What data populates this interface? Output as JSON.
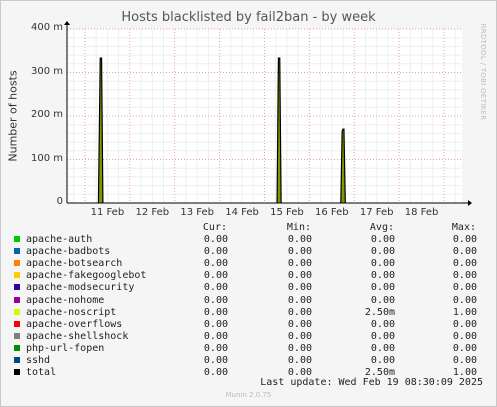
{
  "chart_data": {
    "type": "line",
    "title": "Hosts blacklisted by fail2ban - by week",
    "ylabel": "Number of hosts",
    "ylim": [
      0,
      400
    ],
    "y_unit": "m",
    "yticks": [
      "0",
      "100 m",
      "200 m",
      "300 m",
      "400 m"
    ],
    "ytick_values": [
      0,
      100,
      200,
      300,
      400
    ],
    "xticks": [
      "11 Feb",
      "12 Feb",
      "13 Feb",
      "14 Feb",
      "15 Feb",
      "16 Feb",
      "17 Feb",
      "18 Feb"
    ],
    "xlim_days": [
      10.6,
      19.4
    ],
    "xtick_days": [
      11,
      12,
      13,
      14,
      15,
      16,
      17,
      18
    ],
    "grid": true,
    "series": [
      {
        "name": "apache-noscript",
        "x": [
          11.3,
          11.34,
          11.37,
          11.4,
          15.28,
          15.31,
          15.34,
          15.37,
          16.7,
          16.73,
          16.75,
          16.77,
          16.8
        ],
        "values": [
          0,
          333,
          333,
          0,
          0,
          333,
          333,
          0,
          0,
          165,
          170,
          170,
          0
        ]
      }
    ]
  },
  "legend": {
    "headers": {
      "cur": "Cur:",
      "min": "Min:",
      "avg": "Avg:",
      "max": "Max:"
    },
    "rows": [
      {
        "name": "apache-auth",
        "color": "#00cc00",
        "cur": "0.00",
        "min": "0.00",
        "avg": "0.00",
        "max": "0.00"
      },
      {
        "name": "apache-badbots",
        "color": "#0066b3",
        "cur": "0.00",
        "min": "0.00",
        "avg": "0.00",
        "max": "0.00"
      },
      {
        "name": "apache-botsearch",
        "color": "#ff8000",
        "cur": "0.00",
        "min": "0.00",
        "avg": "0.00",
        "max": "0.00"
      },
      {
        "name": "apache-fakegooglebot",
        "color": "#ffcc00",
        "cur": "0.00",
        "min": "0.00",
        "avg": "0.00",
        "max": "0.00"
      },
      {
        "name": "apache-modsecurity",
        "color": "#330099",
        "cur": "0.00",
        "min": "0.00",
        "avg": "0.00",
        "max": "0.00"
      },
      {
        "name": "apache-nohome",
        "color": "#990099",
        "cur": "0.00",
        "min": "0.00",
        "avg": "0.00",
        "max": "0.00"
      },
      {
        "name": "apache-noscript",
        "color": "#ccff00",
        "cur": "0.00",
        "min": "0.00",
        "avg": "2.50m",
        "max": "1.00"
      },
      {
        "name": "apache-overflows",
        "color": "#ff0000",
        "cur": "0.00",
        "min": "0.00",
        "avg": "0.00",
        "max": "0.00"
      },
      {
        "name": "apache-shellshock",
        "color": "#808080",
        "cur": "0.00",
        "min": "0.00",
        "avg": "0.00",
        "max": "0.00"
      },
      {
        "name": "php-url-fopen",
        "color": "#008f00",
        "cur": "0.00",
        "min": "0.00",
        "avg": "0.00",
        "max": "0.00"
      },
      {
        "name": "sshd",
        "color": "#00487d",
        "cur": "0.00",
        "min": "0.00",
        "avg": "0.00",
        "max": "0.00"
      },
      {
        "name": "total",
        "color": "#000000",
        "cur": "0.00",
        "min": "0.00",
        "avg": "2.50m",
        "max": "1.00"
      }
    ]
  },
  "last_update": "Last update: Wed Feb 19 08:30:09 2025",
  "side_label": "RRDTOOL / TOBI OETIKER",
  "footer": "Munin 2.0.75",
  "colors": {
    "plot_bg": "#ffffff",
    "grid_major": "#e8a0a0",
    "grid_minor": "#eeeeee",
    "spike_fill": "#7a9a00",
    "spike_line": "#000000"
  }
}
